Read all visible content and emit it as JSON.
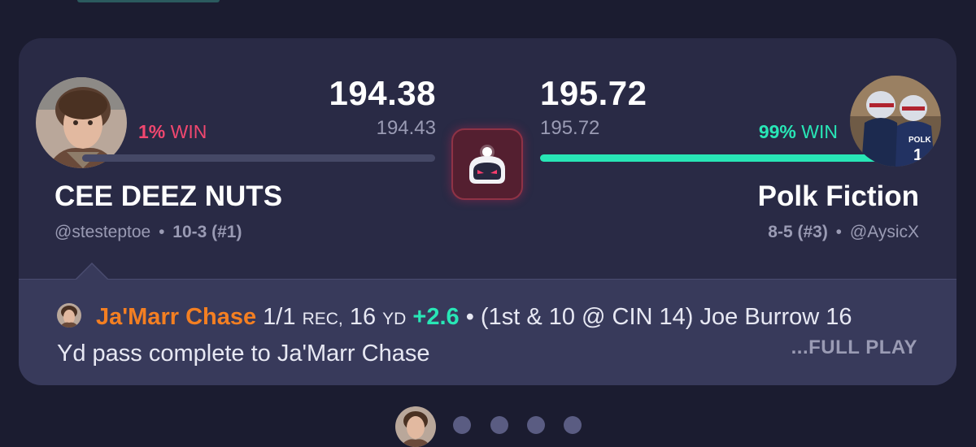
{
  "matchup": {
    "home": {
      "score": "194.38",
      "projected": "194.43",
      "win_pct": "1%",
      "win_label": "WIN",
      "win_color": "#f0476f",
      "win_probability": 0.01,
      "name": "CEE DEEZ NUTS",
      "handle": "@stesteptoe",
      "separator": "•",
      "record": "10-3 (#1)",
      "avatar_icon": "manager-photo-avatar"
    },
    "away": {
      "score": "195.72",
      "projected": "195.72",
      "win_pct": "99%",
      "win_label": "WIN",
      "win_color": "#28e6b6",
      "win_probability": 0.99,
      "name": "Polk Fiction",
      "handle": "@AysicX",
      "separator": "•",
      "record": "8-5 (#3)",
      "avatar_icon": "football-players-photo-avatar"
    },
    "center_icon": "sleeper-robot-logo"
  },
  "play": {
    "player": "Ja'Marr Chase",
    "stat_count": "1/1",
    "stat_unit1": "REC,",
    "yards": "16",
    "stat_unit2": "YD",
    "points": "+2.6",
    "separator": "•",
    "description": "(1st & 10 @ CIN 14) Joe Burrow 16 Yd pass complete to Ja'Marr Chase",
    "full_play_label": "...FULL PLAY"
  },
  "colors": {
    "background": "#1b1c30",
    "card": "#292a45",
    "panel": "#383a5b",
    "accent_green": "#28e6b6",
    "accent_pink": "#f0476f",
    "accent_orange": "#f47f22"
  },
  "pager": {
    "pages": 5,
    "active_index": 0
  }
}
